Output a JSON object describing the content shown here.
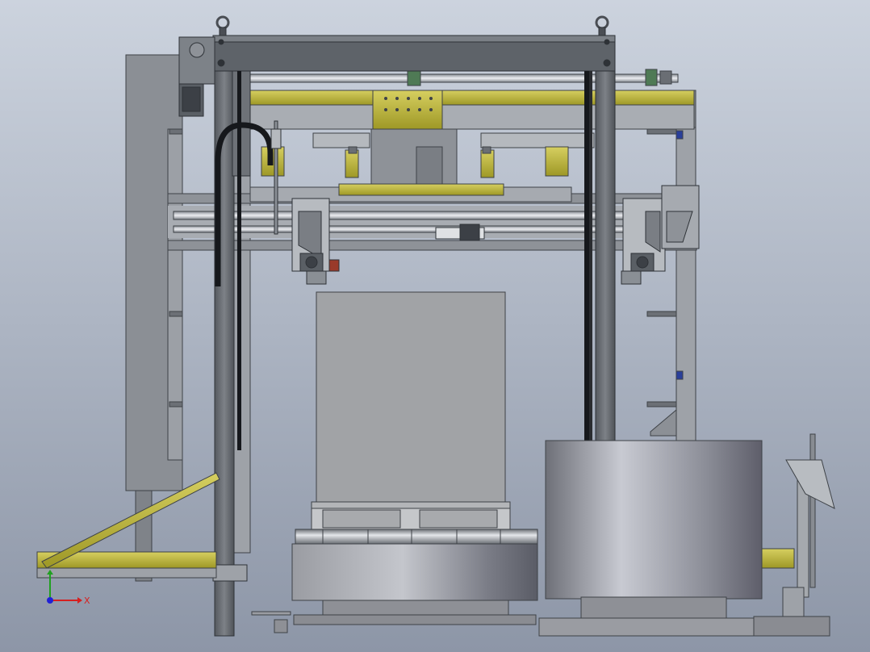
{
  "viewport": {
    "background_top": "#c9d0dc",
    "background_bottom": "#8e97a8"
  },
  "colors": {
    "frame_dark": "#5a5f66",
    "frame_mid": "#8a8f95",
    "frame_light": "#b4b8bd",
    "yellow": "#b7b13a",
    "yellow_dark": "#7e7a1f",
    "hose": "#16181c",
    "motor": "#4a6a4a",
    "blue": "#2a3f9a"
  },
  "triad": {
    "x_label": "X",
    "x_color": "#d62020",
    "y_color": "#20a020",
    "z_color": "#2020d6"
  }
}
